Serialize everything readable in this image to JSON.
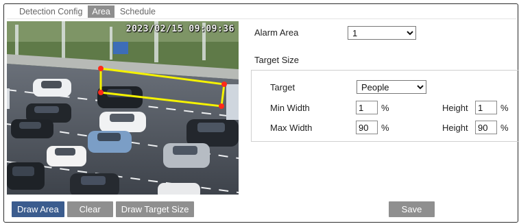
{
  "tabs": [
    {
      "label": "Detection Config",
      "active": false
    },
    {
      "label": "Area",
      "active": true
    },
    {
      "label": "Schedule",
      "active": false
    }
  ],
  "video": {
    "timestamp": "2023/02/15 09:09:36",
    "region_color": "#f5f200",
    "handle_color": "#ff2a1a"
  },
  "buttons": {
    "draw_area": "Draw Area",
    "clear": "Clear",
    "draw_target_size": "Draw Target Size",
    "save": "Save"
  },
  "form": {
    "alarm_area_label": "Alarm Area",
    "alarm_area_value": "1",
    "target_size_label": "Target Size",
    "target_label": "Target",
    "target_value": "People",
    "min_width_label": "Min Width",
    "min_width_value": "1",
    "min_height_label": "Height",
    "min_height_value": "1",
    "max_width_label": "Max Width",
    "max_width_value": "90",
    "max_height_label": "Height",
    "max_height_value": "90",
    "percent": "%"
  },
  "colors": {
    "primary_button": "#3b5c8e",
    "secondary_button": "#8f8f8f",
    "active_tab": "#8e8e8e"
  }
}
